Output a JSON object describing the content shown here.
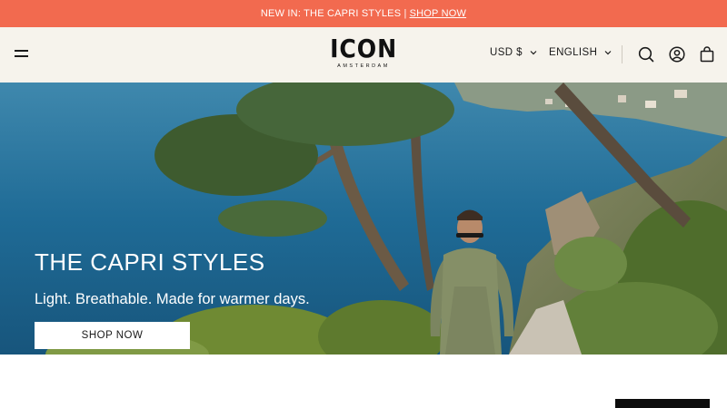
{
  "announcement": {
    "text": "NEW IN: THE CAPRI STYLES |",
    "link": "SHOP NOW"
  },
  "header": {
    "logo": {
      "brand": "ICON",
      "subtitle": "AMSTERDAM"
    },
    "currency": "USD $",
    "language": "ENGLISH",
    "icons": [
      "menu-icon",
      "search-icon",
      "account-icon",
      "cart-icon"
    ]
  },
  "hero": {
    "title": "THE CAPRI STYLES",
    "subtitle": "Light. Breathable. Made for warmer days.",
    "button": "SHOP NOW"
  },
  "colors": {
    "accent": "#f26a4f",
    "header_bg": "#f6f3ec",
    "sea": "#1d6a95",
    "text": "#1a1a1a"
  }
}
